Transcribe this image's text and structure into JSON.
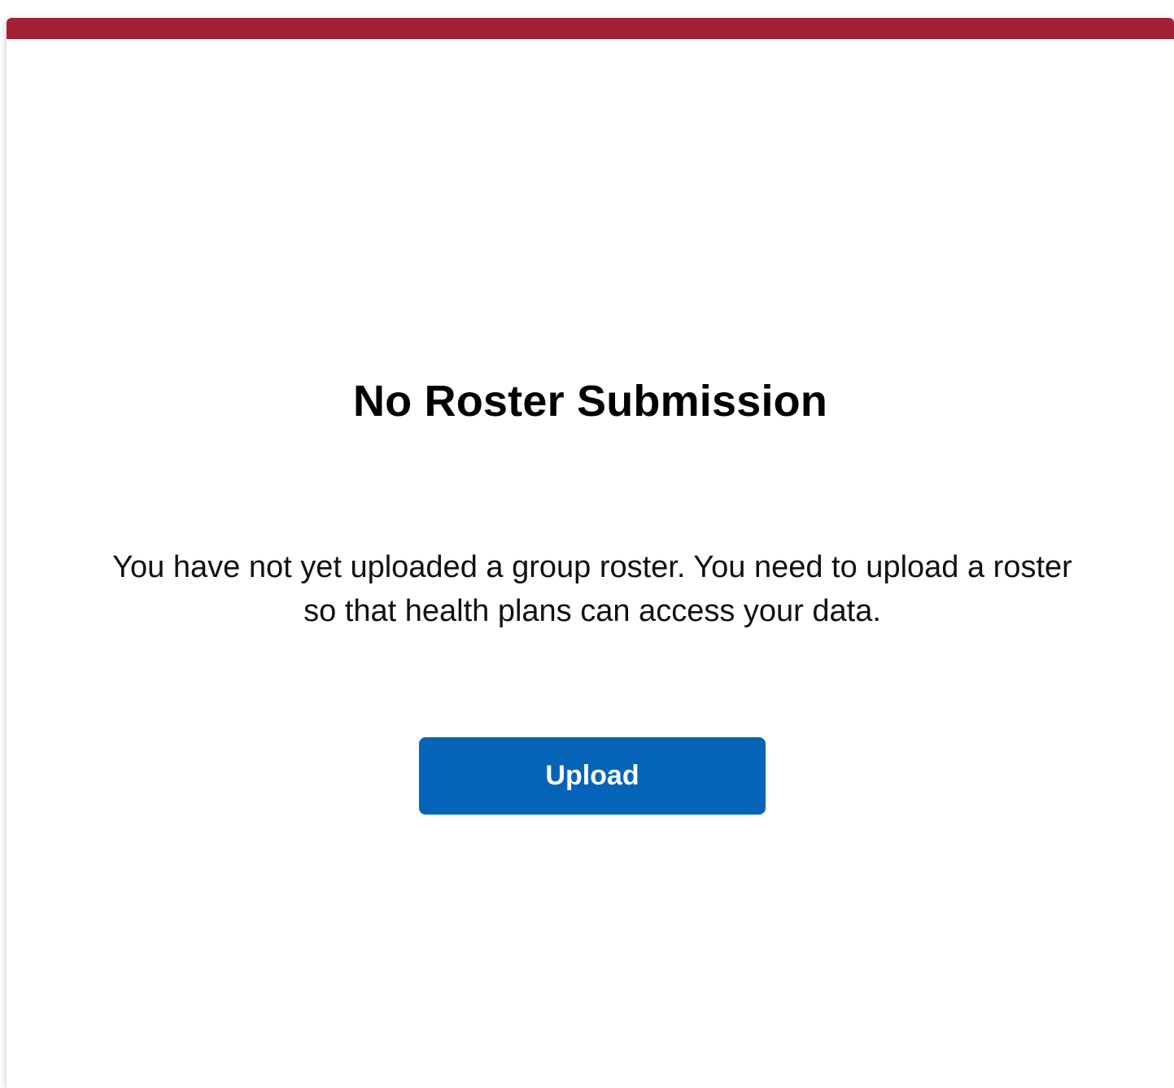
{
  "colors": {
    "accent_bar": "#a12236",
    "primary_button": "#0564b8",
    "button_text": "#ffffff",
    "title_text": "#000000"
  },
  "empty_state": {
    "title": "No Roster Submission",
    "message": "You have not yet uploaded a group roster. You need to upload a roster so that health plans can access your data.",
    "upload_label": "Upload"
  }
}
